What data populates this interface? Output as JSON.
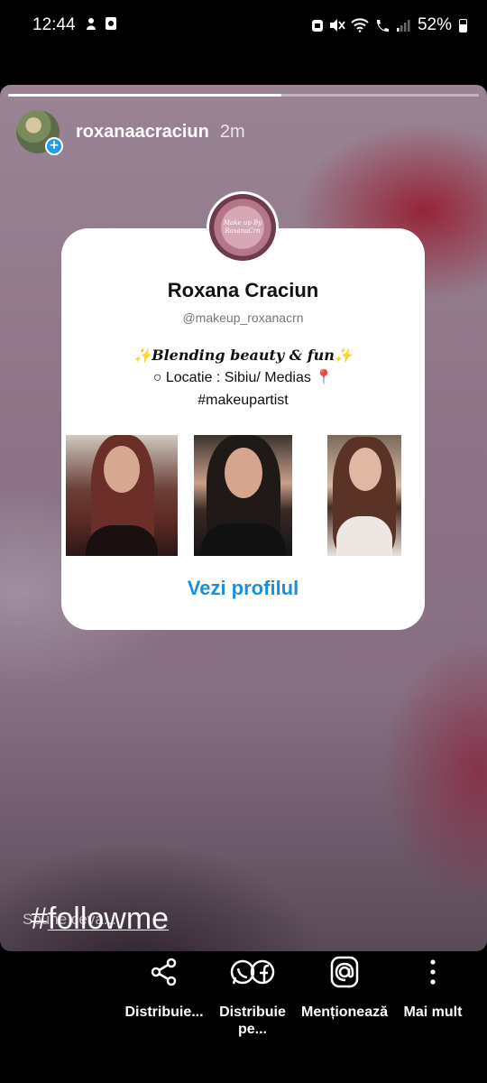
{
  "status_bar": {
    "time": "12:44",
    "battery": "52%"
  },
  "story": {
    "progress_fraction": 0.58,
    "username": "roxanaacraciun",
    "time_ago": "2m",
    "hashtag_prefix": "#",
    "hashtag_word": "followme",
    "reply_placeholder": "Spune ceva..."
  },
  "profile_card": {
    "avatar_text": "Make up By RoxanaCrn",
    "name": "Roxana Craciun",
    "handle": "@makeup_roxanacrn",
    "bio_line1": "✨𝑩𝒍𝒆𝒏𝒅𝒊𝒏𝒈 𝒃𝒆𝒂𝒖𝒕𝒚 & 𝒇𝒖𝒏✨",
    "bio_line2": "○ Locatie : Sibiu/ Medias 📍",
    "bio_line3": "#makeupartist",
    "view_profile": "Vezi profilul"
  },
  "actions": [
    {
      "label": "Distribuie...",
      "icon": "share-icon"
    },
    {
      "label": "Distribuie pe...",
      "icon": "whatsapp-facebook-icon"
    },
    {
      "label": "Menționează",
      "icon": "mention-icon"
    },
    {
      "label": "Mai mult",
      "icon": "more-vertical-icon"
    }
  ]
}
